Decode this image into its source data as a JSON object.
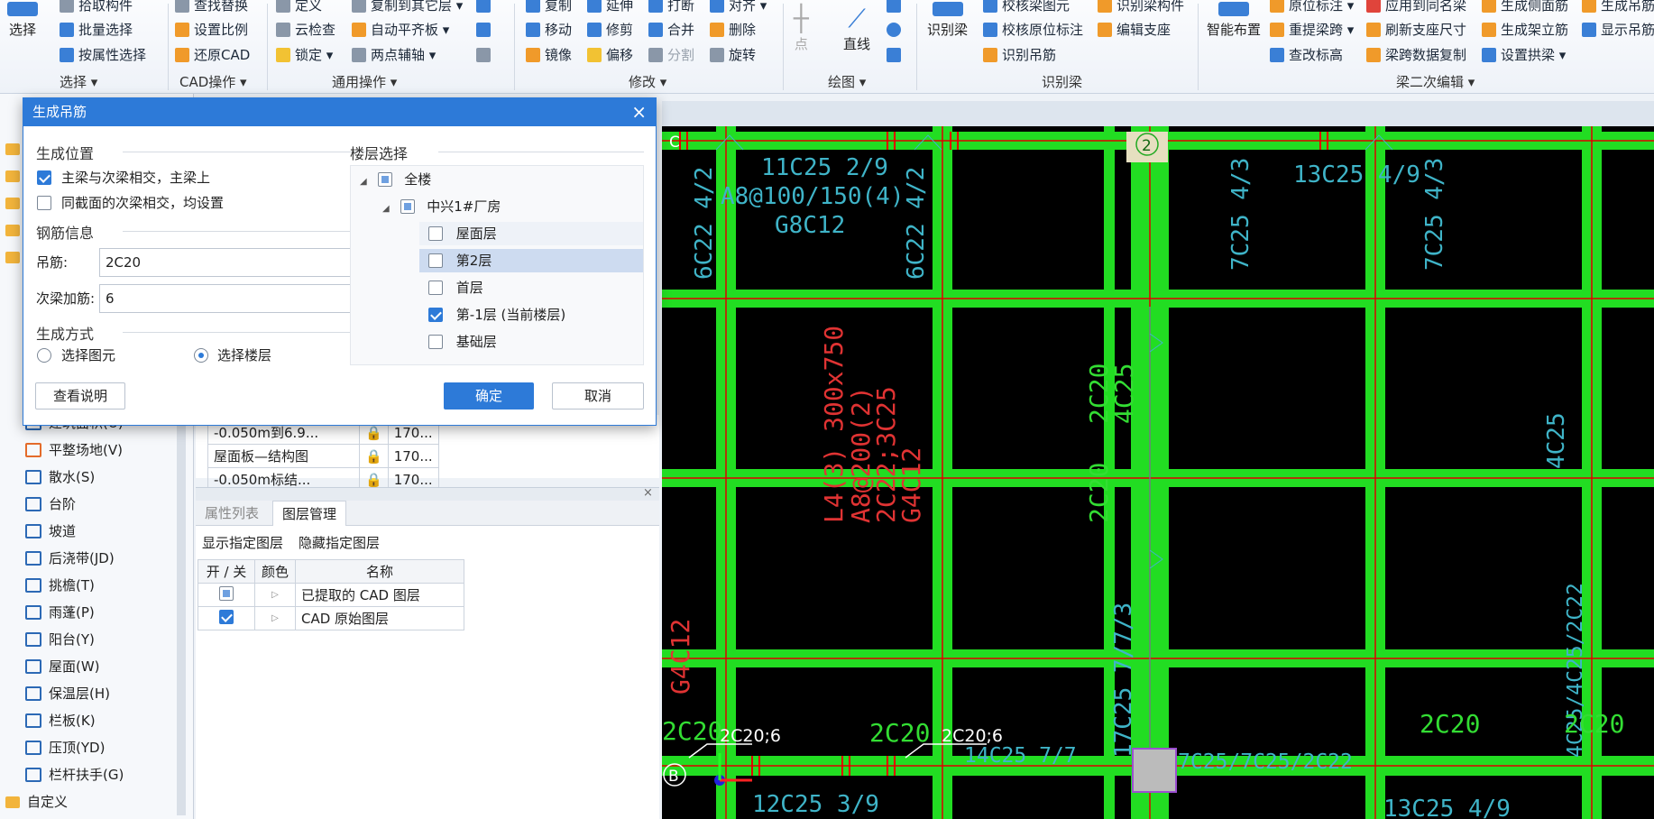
{
  "ribbon": {
    "select": {
      "big": "选择",
      "items": [
        "拾取构件",
        "批量选择",
        "按属性选择"
      ],
      "group": "选择 ▾"
    },
    "cad": {
      "items": [
        "查找替换",
        "设置比例",
        "还原CAD"
      ],
      "group": "CAD操作 ▾"
    },
    "common": {
      "items": [
        "定义",
        "云检查",
        "锁定 ▾",
        "复制到其它层 ▾",
        "自动平齐板 ▾",
        "两点辅轴 ▾"
      ],
      "group": "通用操作 ▾"
    },
    "modify": {
      "items": [
        "复制",
        "延伸",
        "打断",
        "对齐 ▾",
        "移动",
        "修剪",
        "合并",
        "删除",
        "镜像",
        "偏移",
        "分割",
        "旋转"
      ],
      "group": "修改 ▾"
    },
    "draw": {
      "items": [
        "点",
        "直线"
      ],
      "group": "绘图 ▾"
    },
    "beam": {
      "big": "识别梁",
      "items": [
        "校核梁图元",
        "识别梁构件",
        "校核原位标注",
        "编辑支座",
        "识别吊筋"
      ],
      "group": "识别梁"
    },
    "beam2": {
      "big": "智能布置",
      "items": [
        "原位标注 ▾",
        "应用到同名梁",
        "生成侧面筋",
        "生成吊筋",
        "重提梁跨 ▾",
        "刷新支座尺寸",
        "生成架立筋",
        "显示吊筋",
        "查改标高",
        "梁跨数据复制",
        "设置拱梁 ▾"
      ],
      "group": "梁二次编辑 ▾"
    }
  },
  "left_panel": {
    "items": [
      "建筑面积(U)",
      "平整场地(V)",
      "散水(S)",
      "台阶",
      "坡道",
      "后浇带(JD)",
      "挑檐(T)",
      "雨蓬(P)",
      "阳台(Y)",
      "屋面(W)",
      "保温层(H)",
      "栏板(K)",
      "压顶(YD)",
      "栏杆扶手(G)"
    ],
    "custom": "自定义"
  },
  "floor_table": {
    "rows": [
      {
        "name": "-0.050m到6.9...",
        "val": "170..."
      },
      {
        "name": "屋面板—结构图",
        "val": "170..."
      },
      {
        "name": "-0.050m标结...",
        "val": "170..."
      }
    ]
  },
  "layer_panel": {
    "tabs": [
      "属性列表",
      "图层管理"
    ],
    "actions": [
      "显示指定图层",
      "隐藏指定图层"
    ],
    "headers": [
      "开 / 关",
      "颜色",
      "名称"
    ],
    "rows": [
      {
        "name": "已提取的 CAD 图层",
        "on": false
      },
      {
        "name": "CAD 原始图层",
        "on": true
      }
    ]
  },
  "dialog": {
    "title": "生成吊筋",
    "close": "×",
    "pos_title": "生成位置",
    "opt1": "主梁与次梁相交，主梁上",
    "opt2": "同截面的次梁相交，均设置",
    "rebar_title": "钢筋信息",
    "hanger_label": "吊筋:",
    "hanger_value": "2C20",
    "extra_label": "次梁加筋:",
    "extra_value": "6",
    "mode_title": "生成方式",
    "mode1": "选择图元",
    "mode2": "选择楼层",
    "floor_title": "楼层选择",
    "tree": [
      "全楼",
      "中兴1#厂房",
      "屋面层",
      "第2层",
      "首层",
      "第-1层 (当前楼层)",
      "基础层"
    ],
    "help": "查看说明",
    "ok": "确定",
    "cancel": "取消"
  },
  "canvas": {
    "labels": [
      "C",
      "2",
      "B",
      "11C25 2/9",
      "A8@100/150(4)",
      "G8C12",
      "6C22 4/2",
      "13C25 4/9",
      "7C25 4/3",
      "L4(3) 300x750",
      "A8@200(2)",
      "2C22;3C25",
      "G4C12",
      "2C20",
      "4C25",
      "17C25 7/7/3",
      "2C20;6",
      "14C25 7/7",
      "7C25/7C25/2C22",
      "4C25/4C25/2C22",
      "12C25 3/9"
    ]
  },
  "colors": {
    "beam": "#22dd22",
    "axis": "#e00000",
    "cyan": "#3fb4c8",
    "green_text": "#33dd33",
    "accent": "#2d7ad8"
  }
}
